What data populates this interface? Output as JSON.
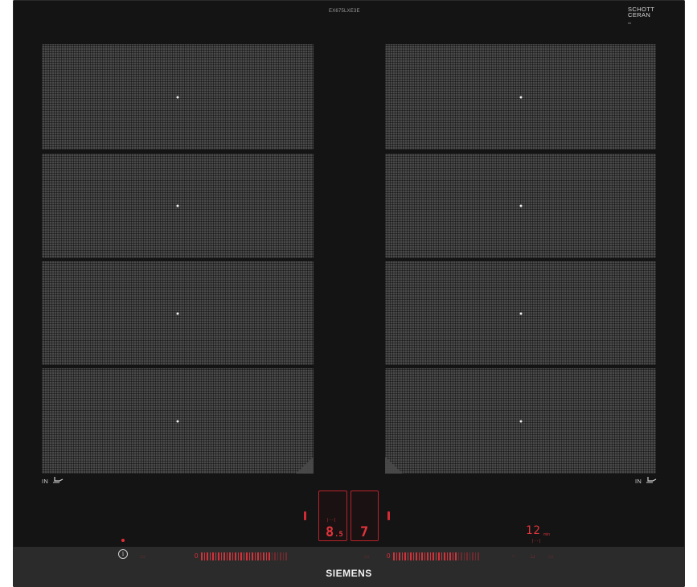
{
  "model_number": "EX675LXE3E",
  "glass_brand": {
    "line1": "SCHOTT",
    "line2": "CERAN",
    "sub": "##"
  },
  "zones": [
    {
      "id": "left-1"
    },
    {
      "id": "left-2"
    },
    {
      "id": "left-3"
    },
    {
      "id": "left-4"
    },
    {
      "id": "right-1"
    },
    {
      "id": "right-2"
    },
    {
      "id": "right-3"
    },
    {
      "id": "right-4"
    }
  ],
  "flex_labels": {
    "left": "IN",
    "right": "IN",
    "icon": "pan-with-hand-icon"
  },
  "display_left": {
    "power": "8",
    "decimal": ".5",
    "small": "|--|"
  },
  "display_right": {
    "power": "7"
  },
  "timer": {
    "value": "12",
    "unit": "min",
    "small": "|--|"
  },
  "slider_left": {
    "zero": "0"
  },
  "slider_right": {
    "zero": "0"
  },
  "info_icon": "info-icon",
  "brand": "SIEMENS",
  "colors": {
    "glass": "#141414",
    "zone": "#4a4a4a",
    "led_red": "#e3343c",
    "panel": "#2b2b2b"
  }
}
